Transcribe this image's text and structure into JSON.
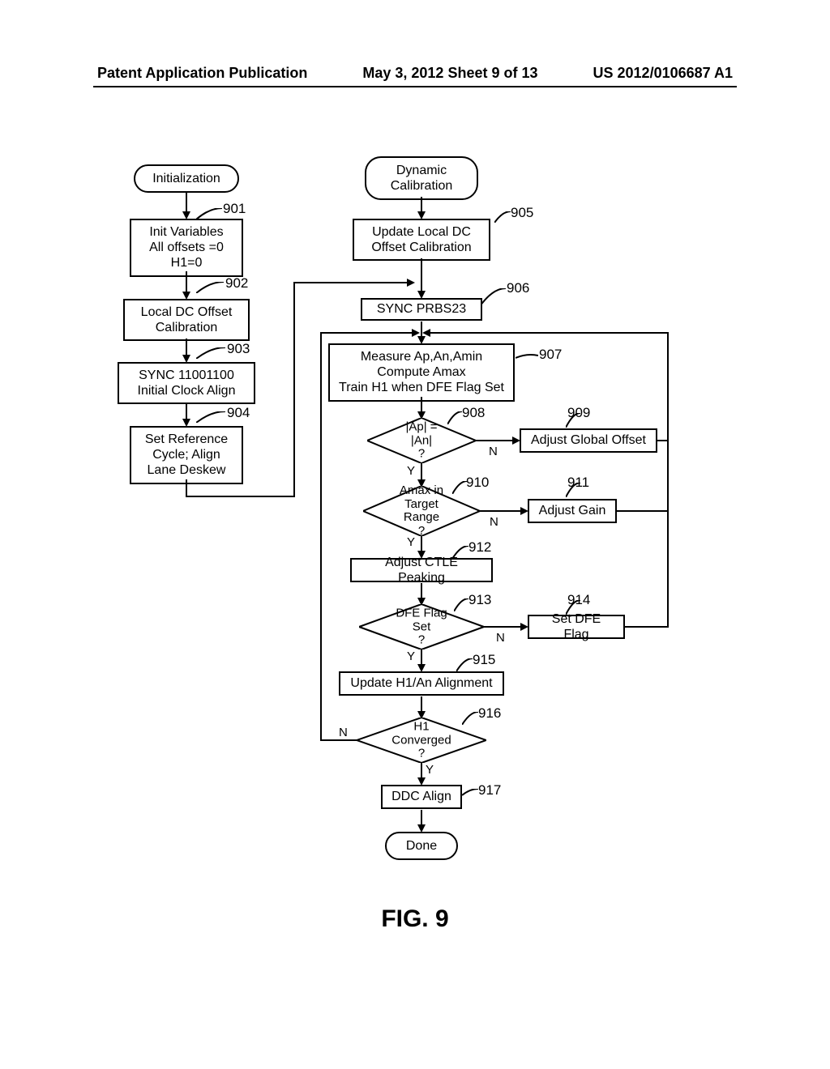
{
  "header": {
    "left": "Patent Application Publication",
    "center": "May 3, 2012  Sheet 9 of 13",
    "right": "US 2012/0106687 A1"
  },
  "figure_label": "FIG. 9",
  "left_flow": {
    "start": "Initialization",
    "n901": "Init Variables\nAll offsets =0\nH1=0",
    "n902": "Local DC Offset\nCalibration",
    "n903": "SYNC 11001100\nInitial Clock Align",
    "n904": "Set Reference\nCycle; Align\nLane Deskew"
  },
  "right_flow": {
    "start": "Dynamic\nCalibration",
    "n905": "Update Local DC\nOffset Calibration",
    "n906": "SYNC PRBS23",
    "n907": "Measure Ap,An,Amin\nCompute Amax\nTrain H1 when DFE Flag Set",
    "n908": "|Ap| = |An|\n?",
    "n909": "Adjust Global Offset",
    "n910": "Amax in\nTarget Range\n?",
    "n911": "Adjust Gain",
    "n912": "Adjust CTLE Peaking",
    "n913": "DFE Flag Set\n?",
    "n914": "Set DFE Flag",
    "n915": "Update H1/An Alignment",
    "n916": "H1 Converged\n?",
    "n917": "DDC Align",
    "done": "Done"
  },
  "refs": {
    "r901": "901",
    "r902": "902",
    "r903": "903",
    "r904": "904",
    "r905": "905",
    "r906": "906",
    "r907": "907",
    "r908": "908",
    "r909": "909",
    "r910": "910",
    "r911": "911",
    "r912": "912",
    "r913": "913",
    "r914": "914",
    "r915": "915",
    "r916": "916",
    "r917": "917"
  },
  "labels": {
    "Y": "Y",
    "N": "N"
  }
}
